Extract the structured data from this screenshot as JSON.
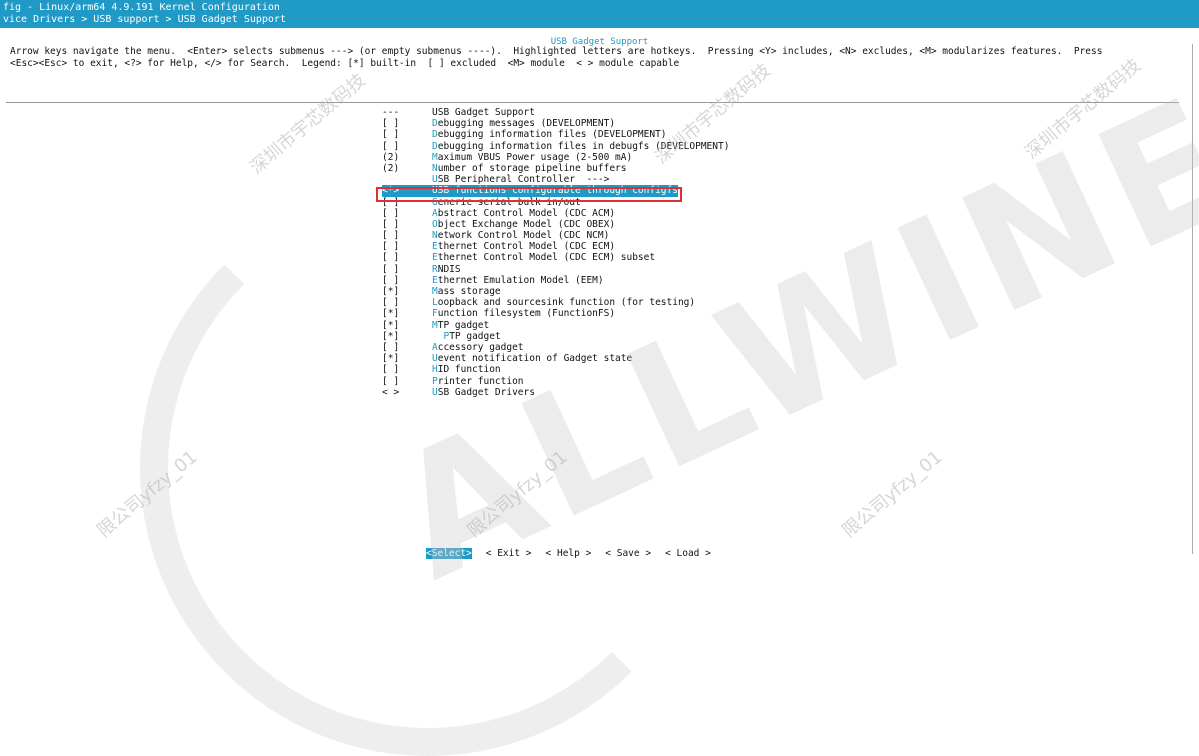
{
  "window": {
    "title_line1": "fig - Linux/arm64 4.9.191 Kernel Configuration",
    "title_line2": "vice Drivers > USB support > USB Gadget Support"
  },
  "panel": {
    "title": "USB Gadget Support",
    "help_line1": "Arrow keys navigate the menu.  <Enter> selects submenus ---> (or empty submenus ----).  Highlighted letters are hotkeys.  Pressing <Y> includes, <N> excludes, <M> modularizes features.  Press",
    "help_line2": "<Esc><Esc> to exit, <?> for Help, </> for Search.  Legend: [*] built-in  [ ] excluded  <M> module  < > module capable"
  },
  "menu": {
    "items": [
      {
        "marker": "---",
        "hotkey": "",
        "text": "USB Gadget Support"
      },
      {
        "marker": "[ ]",
        "hotkey": "D",
        "text": "ebugging messages (DEVELOPMENT)"
      },
      {
        "marker": "[ ]",
        "hotkey": "D",
        "text": "ebugging information files (DEVELOPMENT)"
      },
      {
        "marker": "[ ]",
        "hotkey": "D",
        "text": "ebugging information files in debugfs (DEVELOPMENT)"
      },
      {
        "marker": "(2)",
        "hotkey": "M",
        "text": "aximum VBUS Power usage (2-500 mA)"
      },
      {
        "marker": "(2)",
        "hotkey": "N",
        "text": "umber of storage pipeline buffers"
      },
      {
        "marker": "",
        "hotkey": "U",
        "text": "SB Peripheral Controller  --->"
      },
      {
        "marker": "<*>",
        "hotkey": "U",
        "text": "SB functions configurable through configfs",
        "selected": true
      },
      {
        "marker": "[ ]",
        "hotkey": "G",
        "text": "eneric serial bulk in/out"
      },
      {
        "marker": "[ ]",
        "hotkey": "A",
        "text": "bstract Control Model (CDC ACM)"
      },
      {
        "marker": "[ ]",
        "hotkey": "O",
        "text": "bject Exchange Model (CDC OBEX)"
      },
      {
        "marker": "[ ]",
        "hotkey": "N",
        "text": "etwork Control Model (CDC NCM)"
      },
      {
        "marker": "[ ]",
        "hotkey": "E",
        "text": "thernet Control Model (CDC ECM)"
      },
      {
        "marker": "[ ]",
        "hotkey": "E",
        "text": "thernet Control Model (CDC ECM) subset"
      },
      {
        "marker": "[ ]",
        "hotkey": "R",
        "text": "NDIS"
      },
      {
        "marker": "[ ]",
        "hotkey": "E",
        "text": "thernet Emulation Model (EEM)"
      },
      {
        "marker": "[*]",
        "hotkey": "M",
        "text": "ass storage"
      },
      {
        "marker": "[ ]",
        "hotkey": "L",
        "text": "oopback and sourcesink function (for testing)"
      },
      {
        "marker": "[*]",
        "hotkey": "F",
        "text": "unction filesystem (FunctionFS)"
      },
      {
        "marker": "[*]",
        "hotkey": "M",
        "text": "TP gadget"
      },
      {
        "marker": "[*]",
        "hotkey": "P",
        "text": "TP gadget",
        "indent": true
      },
      {
        "marker": "[ ]",
        "hotkey": "A",
        "text": "ccessory gadget"
      },
      {
        "marker": "[*]",
        "hotkey": "U",
        "text": "event notification of Gadget state"
      },
      {
        "marker": "[ ]",
        "hotkey": "H",
        "text": "ID function"
      },
      {
        "marker": "[ ]",
        "hotkey": "P",
        "text": "rinter function"
      },
      {
        "marker": "< >",
        "hotkey": "U",
        "text": "SB Gadget Drivers"
      }
    ]
  },
  "buttons": [
    {
      "label": "<Select>",
      "active": true
    },
    {
      "label": "< Exit >",
      "hotkey_index": 2
    },
    {
      "label": "< Help >",
      "hotkey_index": 2
    },
    {
      "label": "< Save >",
      "hotkey_index": 2
    },
    {
      "label": "< Load >",
      "hotkey_index": 2
    }
  ],
  "watermark": {
    "brand": "ALLWINER",
    "lines": [
      "深圳市宇芯数码技",
      "深圳市宇芯数码技",
      "深圳市宇芯数码技",
      "限公司yfzy_01",
      "限公司yfzy_01",
      "限公司yfzy_01"
    ]
  },
  "colors": {
    "accent": "#1f9ac6",
    "highlight_box": "#e03030"
  }
}
